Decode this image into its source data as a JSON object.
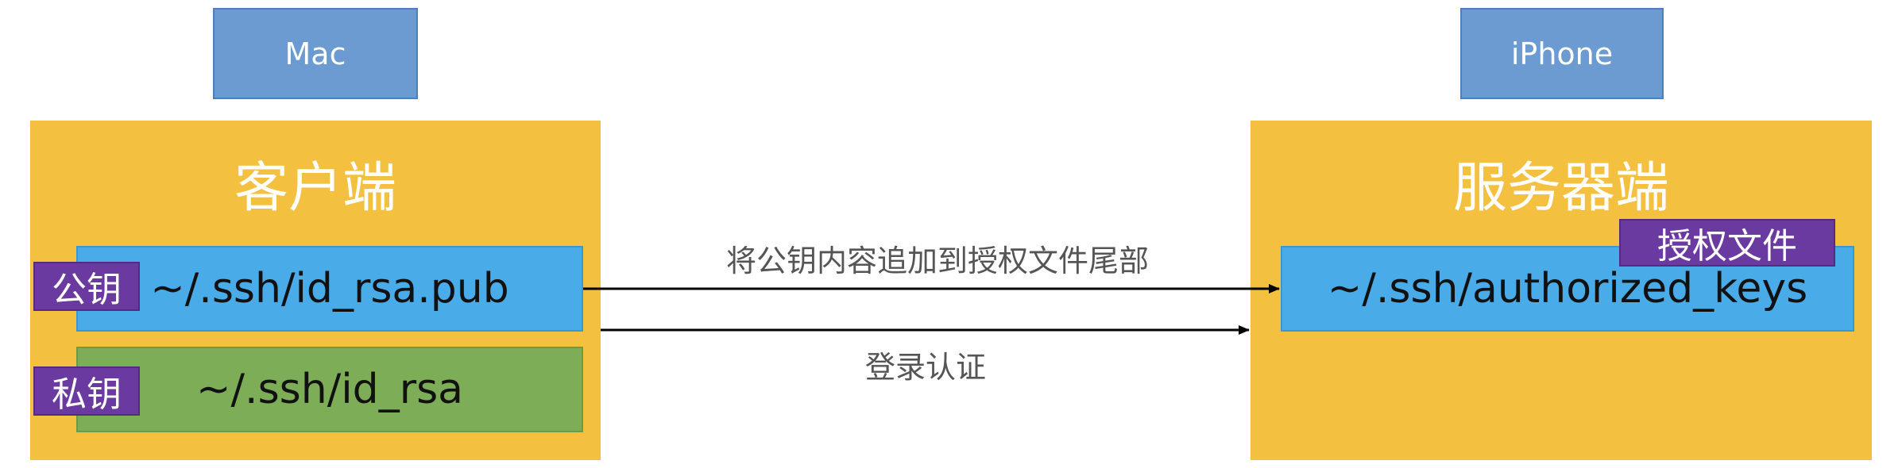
{
  "client": {
    "device": "Mac",
    "title": "客户端",
    "public_key": {
      "tag": "公钥",
      "path": "~/.ssh/id_rsa.pub"
    },
    "private_key": {
      "tag": "私钥",
      "path": "~/.ssh/id_rsa"
    }
  },
  "server": {
    "device": "iPhone",
    "title": "服务器端",
    "authorized": {
      "tag": "授权文件",
      "path": "~/.ssh/authorized_keys"
    }
  },
  "arrows": {
    "append_label": "将公钥内容追加到授权文件尾部",
    "login_label": "登录认证"
  },
  "colors": {
    "panel": "#f4c040",
    "device_tag": "#6b9bd1",
    "public_bar": "#4aabe9",
    "private_bar": "#7dad56",
    "key_tag": "#6a3aa0"
  }
}
